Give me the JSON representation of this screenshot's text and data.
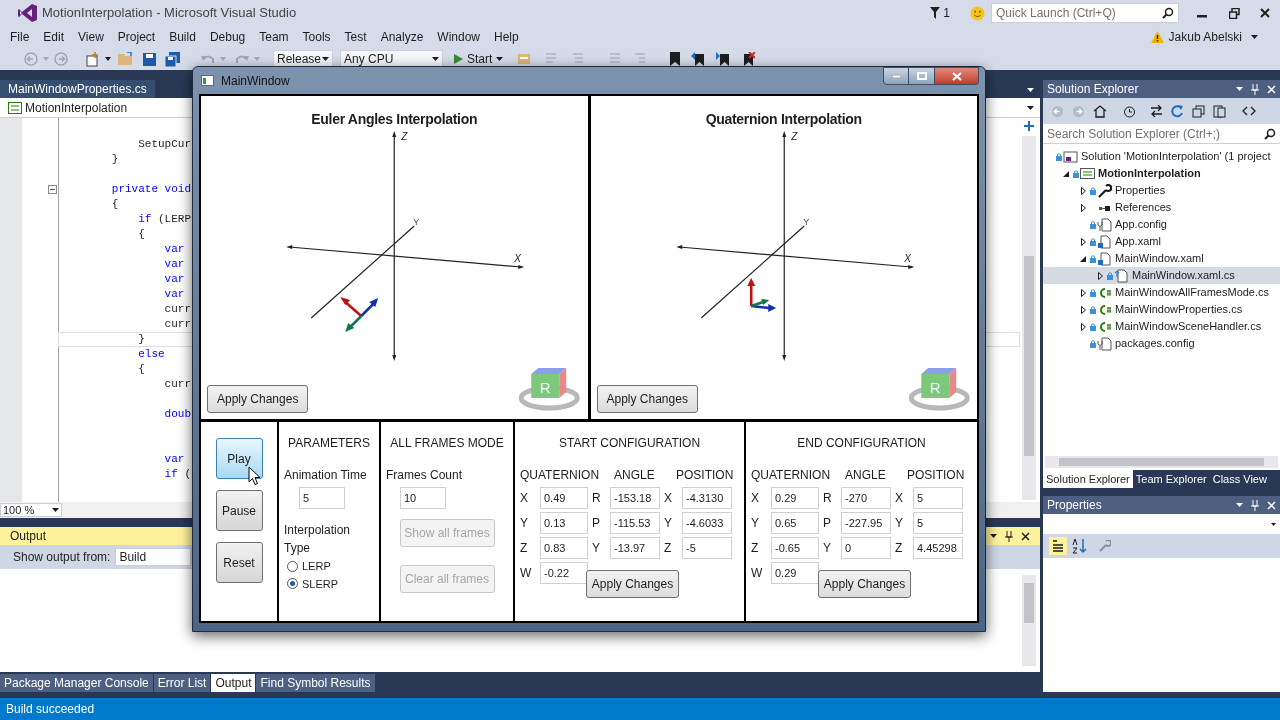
{
  "ide": {
    "title": "MotionInterpolation - Microsoft Visual Studio",
    "notifications": "1",
    "quick_launch": {
      "placeholder": "Quick Launch (Ctrl+Q)"
    },
    "menu": [
      "File",
      "Edit",
      "View",
      "Project",
      "Build",
      "Debug",
      "Team",
      "Tools",
      "Test",
      "Analyze",
      "Window",
      "Help"
    ],
    "user": "Jakub Abelski",
    "toolbar": {
      "configuration": "Release",
      "platform": "Any CPU",
      "start": "Start"
    }
  },
  "editor": {
    "tab": "MainWindowProperties.cs",
    "navigation": "MotionInterpolation",
    "zoom": "100 %",
    "lines": [
      {
        "kind": "blank"
      },
      {
        "kind": "code",
        "collapsible": false,
        "current": false,
        "segments": [
          {
            "text": "            SetupCur",
            "kind": "plain"
          }
        ]
      },
      {
        "kind": "code",
        "collapsible": false,
        "current": false,
        "segments": [
          {
            "text": "        }",
            "kind": "plain"
          }
        ]
      },
      {
        "kind": "blank"
      },
      {
        "kind": "code",
        "collapsible": true,
        "current": false,
        "segments": [
          {
            "text": "        private void",
            "kind": "keyword"
          }
        ]
      },
      {
        "kind": "code",
        "collapsible": false,
        "current": false,
        "segments": [
          {
            "text": "        {",
            "kind": "plain"
          }
        ]
      },
      {
        "kind": "code",
        "collapsible": false,
        "current": false,
        "segments": [
          {
            "text": "            if",
            "kind": "keyword"
          },
          {
            "text": " (LERP",
            "kind": "plain"
          }
        ]
      },
      {
        "kind": "code",
        "collapsible": false,
        "current": false,
        "segments": [
          {
            "text": "            {",
            "kind": "plain"
          }
        ]
      },
      {
        "kind": "code",
        "collapsible": false,
        "current": false,
        "segments": [
          {
            "text": "                var",
            "kind": "keyword"
          }
        ]
      },
      {
        "kind": "code",
        "collapsible": false,
        "current": false,
        "segments": [
          {
            "text": "                var",
            "kind": "keyword"
          }
        ]
      },
      {
        "kind": "code",
        "collapsible": false,
        "current": false,
        "segments": [
          {
            "text": "                var",
            "kind": "keyword"
          }
        ]
      },
      {
        "kind": "code",
        "collapsible": false,
        "current": false,
        "segments": [
          {
            "text": "                var",
            "kind": "keyword"
          }
        ]
      },
      {
        "kind": "code",
        "collapsible": false,
        "current": false,
        "segments": [
          {
            "text": "                curr",
            "kind": "plain"
          }
        ]
      },
      {
        "kind": "code",
        "collapsible": false,
        "current": false,
        "segments": [
          {
            "text": "                curr",
            "kind": "plain"
          }
        ]
      },
      {
        "kind": "code",
        "collapsible": false,
        "current": true,
        "segments": [
          {
            "text": "            }",
            "kind": "plain"
          }
        ]
      },
      {
        "kind": "code",
        "collapsible": false,
        "current": false,
        "segments": [
          {
            "text": "            else",
            "kind": "keyword"
          }
        ]
      },
      {
        "kind": "code",
        "collapsible": false,
        "current": false,
        "segments": [
          {
            "text": "            {",
            "kind": "plain"
          }
        ]
      },
      {
        "kind": "code",
        "collapsible": false,
        "current": false,
        "segments": [
          {
            "text": "                curr",
            "kind": "plain"
          }
        ]
      },
      {
        "kind": "blank"
      },
      {
        "kind": "code",
        "collapsible": false,
        "current": false,
        "segments": [
          {
            "text": "                doub",
            "kind": "keyword"
          }
        ]
      },
      {
        "kind": "blank"
      },
      {
        "kind": "blank"
      },
      {
        "kind": "code",
        "collapsible": false,
        "current": false,
        "segments": [
          {
            "text": "                var",
            "kind": "keyword"
          }
        ]
      },
      {
        "kind": "code",
        "collapsible": false,
        "current": false,
        "segments": [
          {
            "text": "                if",
            "kind": "keyword"
          },
          {
            "text": " (",
            "kind": "plain"
          }
        ]
      }
    ]
  },
  "output": {
    "title": "Output",
    "show_from_label": "Show output from:",
    "source": "Build"
  },
  "bottom_tabs": [
    {
      "label": "Package Manager Console",
      "selected": false
    },
    {
      "label": "Error List",
      "selected": false
    },
    {
      "label": "Output",
      "selected": true
    },
    {
      "label": "Find Symbol Results",
      "selected": false
    }
  ],
  "status_bar": "Build succeeded",
  "solution_explorer": {
    "title": "Solution Explorer",
    "search": {
      "placeholder": "Search Solution Explorer (Ctrl+;)"
    },
    "tree": [
      {
        "label": "Solution 'MotionInterpolation' (1 project",
        "kind": "solution",
        "expandable": false,
        "selected": false,
        "children": [
          {
            "label": "MotionInterpolation",
            "kind": "project",
            "expandable": true,
            "expanded": true,
            "selected": false,
            "children": [
              {
                "label": "Properties",
                "kind": "properties",
                "expandable": true,
                "expanded": false,
                "selected": false
              },
              {
                "label": "References",
                "kind": "references",
                "expandable": true,
                "expanded": false,
                "selected": false
              },
              {
                "label": "App.config",
                "kind": "config",
                "expandable": false,
                "selected": false
              },
              {
                "label": "App.xaml",
                "kind": "xaml",
                "expandable": true,
                "expanded": false,
                "selected": false
              },
              {
                "label": "MainWindow.xaml",
                "kind": "xaml",
                "expandable": true,
                "expanded": true,
                "selected": false,
                "children": [
                  {
                    "label": "MainWindow.xaml.cs",
                    "kind": "codebehind",
                    "expandable": true,
                    "expanded": false,
                    "selected": true
                  }
                ]
              },
              {
                "label": "MainWindowAllFramesMode.cs",
                "kind": "cs",
                "expandable": true,
                "expanded": false,
                "selected": false
              },
              {
                "label": "MainWindowProperties.cs",
                "kind": "cs",
                "expandable": true,
                "expanded": false,
                "selected": false
              },
              {
                "label": "MainWindowSceneHandler.cs",
                "kind": "cs",
                "expandable": true,
                "expanded": false,
                "selected": false
              },
              {
                "label": "packages.config",
                "kind": "config",
                "expandable": false,
                "selected": false
              }
            ]
          }
        ]
      }
    ],
    "tabs": [
      {
        "label": "Solution Explorer",
        "selected": true
      },
      {
        "label": "Team Explorer",
        "selected": false
      },
      {
        "label": "Class View",
        "selected": false
      }
    ]
  },
  "properties": {
    "title": "Properties"
  },
  "app_window": {
    "title": "MainWindow",
    "viewports": [
      {
        "title": "Euler Angles Interpolation",
        "axis_labels": [
          "Z",
          "Y",
          "X"
        ],
        "cube_face": "R",
        "apply": "Apply Changes"
      },
      {
        "title": "Quaternion Interpolation",
        "axis_labels": [
          "Z",
          "Y",
          "X"
        ],
        "cube_face": "R",
        "apply": "Apply Changes"
      }
    ],
    "playback": [
      {
        "label": "Play",
        "focused": true
      },
      {
        "label": "Pause",
        "focused": false
      },
      {
        "label": "Reset",
        "focused": false
      }
    ],
    "parameters": {
      "heading": "PARAMETERS",
      "animation_time_label": "Animation Time",
      "animation_time": "5",
      "interpolation_label": "Interpolation Type",
      "options": [
        {
          "label": "LERP",
          "selected": false
        },
        {
          "label": "SLERP",
          "selected": true
        }
      ]
    },
    "all_frames": {
      "heading": "ALL FRAMES MODE",
      "frames_count_label": "Frames Count",
      "frames_count": "10",
      "buttons": [
        {
          "label": "Show all frames",
          "disabled": true
        },
        {
          "label": "Clear all frames",
          "disabled": true
        }
      ]
    },
    "configurations": [
      {
        "heading": "START CONFIGURATION",
        "columns": [
          "QUATERNION",
          "ANGLE",
          "POSITION"
        ],
        "quaternion": [
          {
            "axis": "X",
            "value": "0.49"
          },
          {
            "axis": "Y",
            "value": "0.13"
          },
          {
            "axis": "Z",
            "value": "0.83"
          },
          {
            "axis": "W",
            "value": "-0.22"
          }
        ],
        "angle": [
          {
            "axis": "R",
            "value": "-153.18"
          },
          {
            "axis": "P",
            "value": "-115.53"
          },
          {
            "axis": "Y",
            "value": "-13.97"
          }
        ],
        "position": [
          {
            "axis": "X",
            "value": "-4.3130"
          },
          {
            "axis": "Y",
            "value": "-4.6033"
          },
          {
            "axis": "Z",
            "value": "-5"
          }
        ],
        "apply": "Apply Changes"
      },
      {
        "heading": "END CONFIGURATION",
        "columns": [
          "QUATERNION",
          "ANGLE",
          "POSITION"
        ],
        "quaternion": [
          {
            "axis": "X",
            "value": "0.29"
          },
          {
            "axis": "Y",
            "value": "0.65"
          },
          {
            "axis": "Z",
            "value": "-0.65"
          },
          {
            "axis": "W",
            "value": "0.29"
          }
        ],
        "angle": [
          {
            "axis": "R",
            "value": "-270"
          },
          {
            "axis": "P",
            "value": "-227.95"
          },
          {
            "axis": "Y",
            "value": "0"
          }
        ],
        "position": [
          {
            "axis": "X",
            "value": "5"
          },
          {
            "axis": "Y",
            "value": "5"
          },
          {
            "axis": "Z",
            "value": "4.45298"
          }
        ],
        "apply": "Apply Changes"
      }
    ]
  }
}
